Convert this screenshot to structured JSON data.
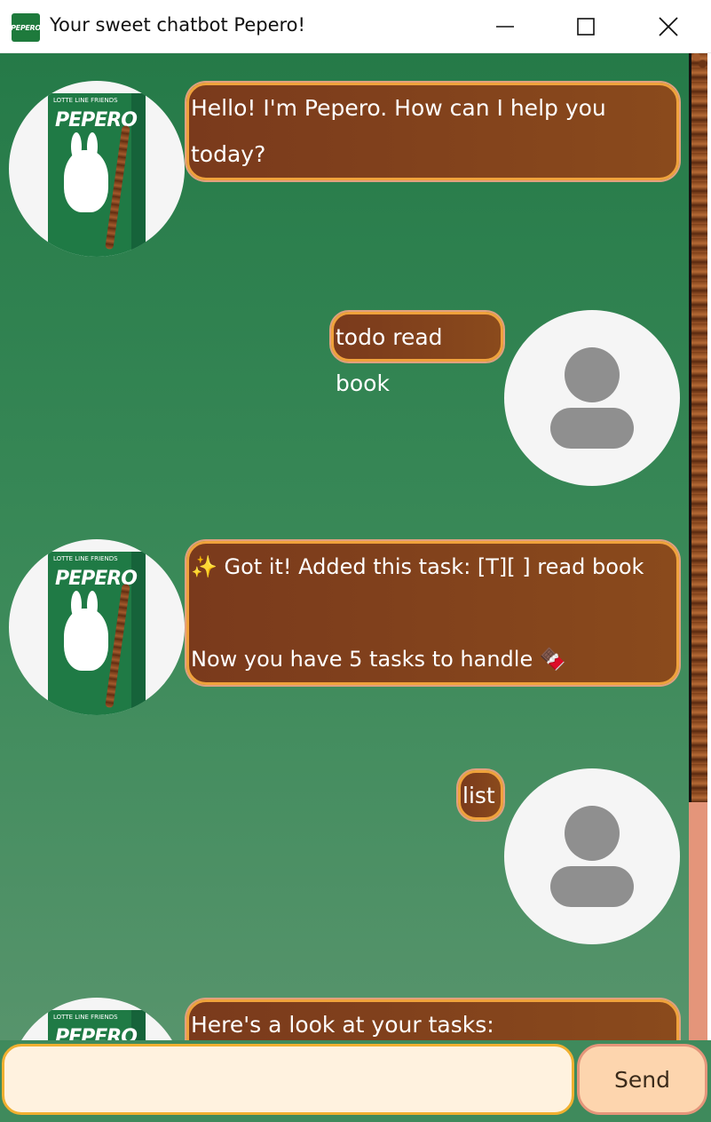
{
  "window": {
    "title": "Your sweet chatbot Pepero!",
    "icon_text": "PEPERO",
    "controls": [
      "minimize-icon",
      "maximize-icon",
      "close-icon"
    ]
  },
  "bot_avatar": {
    "brand": "PEPERO",
    "brand_top": "LOTTE   LINE FRIENDS"
  },
  "messages": [
    {
      "sender": "bot",
      "text": "Hello! I'm Pepero. How can I help you\ntoday?"
    },
    {
      "sender": "user",
      "text": "todo read book"
    },
    {
      "sender": "bot",
      "text": "✨ Got it! Added this task: [T][ ] read book\n\nNow you have 5 tasks to handle 🍫"
    },
    {
      "sender": "user",
      "text": "list"
    },
    {
      "sender": "bot",
      "text": "Here's a look at your tasks:"
    }
  ],
  "input": {
    "value": "",
    "placeholder": ""
  },
  "send_button": {
    "label": "Send"
  },
  "colors": {
    "chat_bg_top": "#257a48",
    "bubble_fill": "#7a3a1c",
    "bubble_border": "#f0a23b",
    "input_bg": "#fff2df",
    "send_bg": "#fdd5ae",
    "scrollbar_track": "#e4957a"
  }
}
